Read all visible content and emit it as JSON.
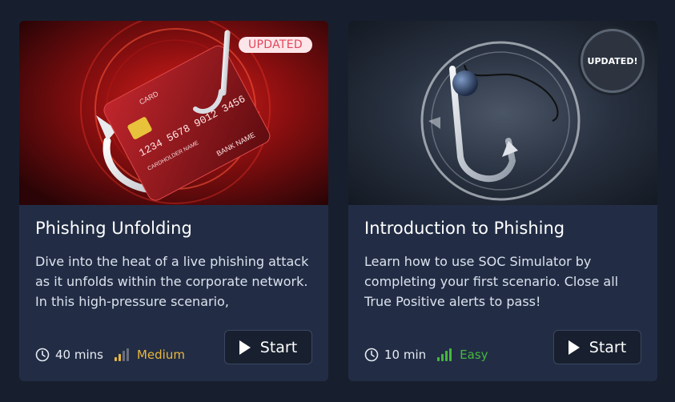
{
  "cards": [
    {
      "badge": "UPDATED",
      "title": "Phishing Unfolding",
      "description": "Dive into the heat of a live phishing attack as it unfolds within the corporate network. In this high-pressure scenario,",
      "duration": "40 mins",
      "difficulty": "Medium",
      "difficulty_color": "#e9b73d",
      "start_label": "Start",
      "image": {
        "card_brand": "CARD",
        "card_number": "1234 5678 9012 3456",
        "card_holder": "CARDHOLDER NAME",
        "bank_name": "BANK NAME",
        "icons": [
          "credit-card-icon",
          "fishing-hook-icon",
          "chip-icon"
        ]
      }
    },
    {
      "badge": "UPDATED!",
      "title": "Introduction to Phishing",
      "description": "Learn how to use SOC Simulator by completing your first scenario. Close all True Positive alerts to pass!",
      "duration": "10 min",
      "difficulty": "Easy",
      "difficulty_color": "#45b83b",
      "start_label": "Start",
      "image": {
        "icons": [
          "fishing-hook-icon",
          "sinker-icon"
        ]
      }
    }
  ]
}
